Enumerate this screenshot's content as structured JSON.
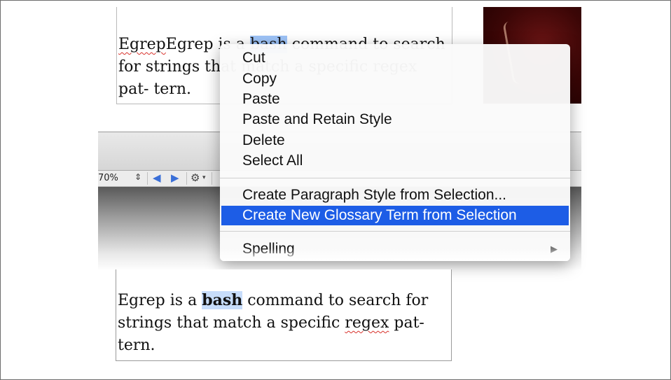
{
  "top_document": {
    "before": "Egrep is a ",
    "selected": "bash",
    "after": " command to search for strings that match a specific regex pat- tern."
  },
  "status_bar": {
    "zoom": "70%",
    "zoom_stepper": "⇕",
    "prev_icon": "◀",
    "next_icon": "▶",
    "gear_icon": "⚙",
    "gear_caret": "▾"
  },
  "context_menu": {
    "items": [
      {
        "label": "Cut"
      },
      {
        "label": "Copy"
      },
      {
        "label": "Paste"
      },
      {
        "label": "Paste and Retain Style"
      },
      {
        "label": "Delete"
      },
      {
        "label": "Select All"
      },
      {
        "label": "Create Paragraph Style from Selection..."
      },
      {
        "label": "Create New Glossary Term from Selection"
      },
      {
        "label": "Spelling"
      }
    ],
    "submenu_arrow": "▶"
  },
  "bottom_document": {
    "before": "Egrep is a ",
    "selected": "bash",
    "mid": " command to search for strings that match a specific ",
    "misspelled": "regex",
    "after": " pat- tern."
  },
  "colors": {
    "highlight": "#1d5de6",
    "selection": "#9dc3f7",
    "spelling_underline": "#d8312a"
  }
}
